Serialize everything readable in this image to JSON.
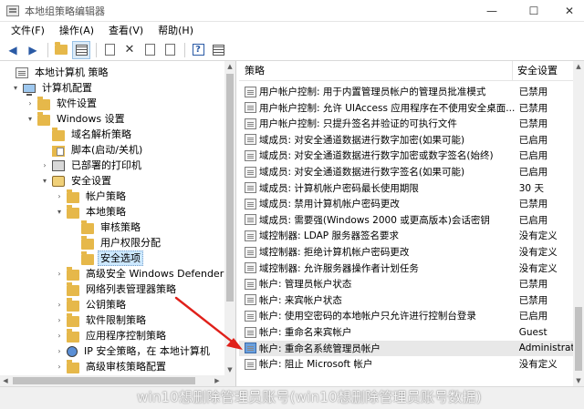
{
  "window": {
    "title": "本地组策略编辑器",
    "minimize": "—",
    "maximize": "☐",
    "close": "✕"
  },
  "menu": [
    "文件(F)",
    "操作(A)",
    "查看(V)",
    "帮助(H)"
  ],
  "tree": {
    "items": [
      {
        "label": "本地计算机 策略",
        "icon": "policy-icon",
        "arrow": ""
      },
      {
        "label": "计算机配置",
        "icon": "computer-icon",
        "arrow": "▾"
      },
      {
        "label": "软件设置",
        "icon": "folder-icon",
        "arrow": "›"
      },
      {
        "label": "Windows 设置",
        "icon": "folder-icon",
        "arrow": "▾"
      },
      {
        "label": "域名解析策略",
        "icon": "folder-icon",
        "arrow": ""
      },
      {
        "label": "脚本(启动/关机)",
        "icon": "script-icon",
        "arrow": ""
      },
      {
        "label": "已部署的打印机",
        "icon": "printer-icon",
        "arrow": "›"
      },
      {
        "label": "安全设置",
        "icon": "lock-icon",
        "arrow": "▾"
      },
      {
        "label": "帐户策略",
        "icon": "folder-icon",
        "arrow": "›"
      },
      {
        "label": "本地策略",
        "icon": "folder-icon",
        "arrow": "▾"
      },
      {
        "label": "审核策略",
        "icon": "folder-icon",
        "arrow": ""
      },
      {
        "label": "用户权限分配",
        "icon": "folder-icon",
        "arrow": ""
      },
      {
        "label": "安全选项",
        "icon": "folder-icon",
        "arrow": ""
      },
      {
        "label": "高级安全 Windows Defender 防",
        "icon": "folder-icon",
        "arrow": "›"
      },
      {
        "label": "网络列表管理器策略",
        "icon": "folder-icon",
        "arrow": ""
      },
      {
        "label": "公钥策略",
        "icon": "folder-icon",
        "arrow": "›"
      },
      {
        "label": "软件限制策略",
        "icon": "folder-icon",
        "arrow": "›"
      },
      {
        "label": "应用程序控制策略",
        "icon": "folder-icon",
        "arrow": "›"
      },
      {
        "label": "IP 安全策略，在 本地计算机",
        "icon": "network-icon",
        "arrow": "›"
      },
      {
        "label": "高级审核策略配置",
        "icon": "folder-icon",
        "arrow": "›"
      }
    ]
  },
  "list": {
    "header_policy": "策略",
    "header_setting": "安全设置",
    "rows": [
      {
        "name": "用户帐户控制: 用于内置管理员帐户的管理员批准模式",
        "setting": "已禁用"
      },
      {
        "name": "用户帐户控制: 允许 UIAccess 应用程序在不使用安全桌面...",
        "setting": "已禁用"
      },
      {
        "name": "用户帐户控制: 只提升签名并验证的可执行文件",
        "setting": "已禁用"
      },
      {
        "name": "域成员: 对安全通道数据进行数字加密(如果可能)",
        "setting": "已启用"
      },
      {
        "name": "域成员: 对安全通道数据进行数字加密或数字签名(始终)",
        "setting": "已启用"
      },
      {
        "name": "域成员: 对安全通道数据进行数字签名(如果可能)",
        "setting": "已启用"
      },
      {
        "name": "域成员: 计算机帐户密码最长使用期限",
        "setting": "30 天"
      },
      {
        "name": "域成员: 禁用计算机帐户密码更改",
        "setting": "已禁用"
      },
      {
        "name": "域成员: 需要强(Windows 2000 或更高版本)会话密钥",
        "setting": "已启用"
      },
      {
        "name": "域控制器: LDAP 服务器签名要求",
        "setting": "没有定义"
      },
      {
        "name": "域控制器: 拒绝计算机帐户密码更改",
        "setting": "没有定义"
      },
      {
        "name": "域控制器: 允许服务器操作者计划任务",
        "setting": "没有定义"
      },
      {
        "name": "帐户: 管理员帐户状态",
        "setting": "已禁用"
      },
      {
        "name": "帐户: 来宾帐户状态",
        "setting": "已禁用"
      },
      {
        "name": "帐户: 使用空密码的本地帐户只允许进行控制台登录",
        "setting": "已启用"
      },
      {
        "name": "帐户: 重命名来宾帐户",
        "setting": "Guest"
      },
      {
        "name": "帐户: 重命名系统管理员帐户",
        "setting": "Administrat"
      },
      {
        "name": "帐户: 阻止 Microsoft 帐户",
        "setting": "没有定义"
      }
    ]
  },
  "watermark": "win10想删除管理员账号(win10想删除管理员账号数据)"
}
